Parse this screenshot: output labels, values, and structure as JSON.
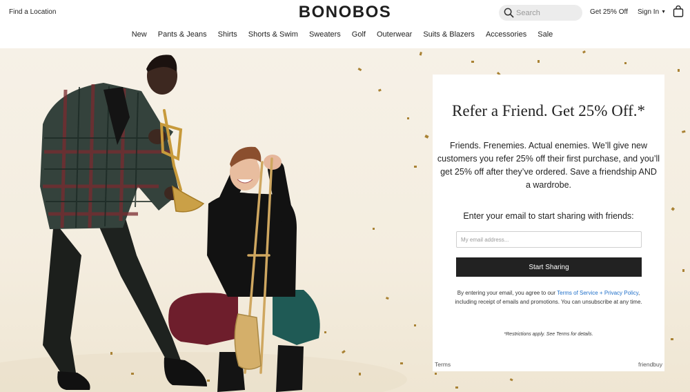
{
  "header": {
    "find_location": "Find a Location",
    "logo": "BONOBOS",
    "search_placeholder": "Search",
    "promo": "Get 25% Off",
    "sign_in": "Sign In",
    "icons": {
      "search": "search-icon",
      "sign_in_caret": "caret-down-icon",
      "bag": "shopping-bag-icon"
    }
  },
  "nav": {
    "items": [
      "New",
      "Pants & Jeans",
      "Shirts",
      "Shorts & Swim",
      "Sweaters",
      "Golf",
      "Outerwear",
      "Suits & Blazers",
      "Accessories",
      "Sale"
    ]
  },
  "referral": {
    "title": "Refer a Friend. Get 25% Off.*",
    "body": "Friends. Frenemies. Actual enemies.  We’ll give new customers you refer 25% off their first purchase, and you’ll get 25% off after they’ve ordered. Save a friendship AND a wardrobe.",
    "prompt": "Enter your email to start sharing with friends:",
    "email_placeholder": "My email address...",
    "button": "Start Sharing",
    "legal_before": "By entering your email, you agree to our ",
    "legal_link": "Terms of Service + Privacy Policy",
    "legal_after": ", including receipt of emails and promotions. You can unsubscribe at any time.",
    "restrictions": "*Restrictions apply. See Terms for details.",
    "footer_terms": "Terms",
    "footer_brand": "friendbuy"
  },
  "colors": {
    "brand_text": "#1e1e1e",
    "button_bg": "#222222",
    "link": "#1f6fc9",
    "hero_bg": "#f4eddf",
    "confetti": "#b08a3e"
  }
}
